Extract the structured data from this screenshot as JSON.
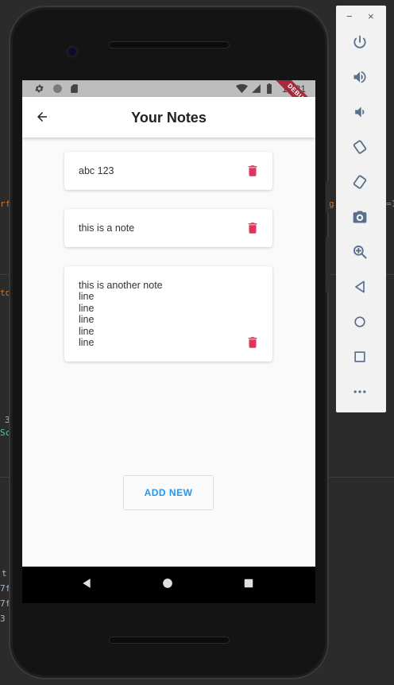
{
  "ide": {
    "frag_1": "rf",
    "frag_2": "to",
    "frag_3": "3",
    "frag_4": "Sc",
    "frag_5": "t",
    "frag_6": "7f",
    "frag_7": "7f",
    "frag_8": "3",
    "frag_9": "g",
    "frag_10": "=1"
  },
  "status_bar": {
    "time": "10:21",
    "debug_label": "DEBUG"
  },
  "app_bar": {
    "title": "Your Notes"
  },
  "notes": [
    {
      "text": "abc 123"
    },
    {
      "text": "this is a note"
    },
    {
      "text": "this is another note\nline\nline\nline\nline\nline"
    }
  ],
  "actions": {
    "add_new_label": "ADD NEW"
  },
  "emulator": {
    "minimize": "−",
    "close": "×"
  },
  "colors": {
    "accent": "#2196f3",
    "trash": "#e0345c",
    "status_bar": "#bdbdbd",
    "debug_banner": "#a52a3a"
  },
  "icons": {
    "back": "arrow-left-icon",
    "delete": "trash-icon",
    "power": "power-icon",
    "volume_up": "volume-up-icon",
    "volume_down": "volume-down-icon",
    "rotate_left": "rotate-left-icon",
    "rotate_right": "rotate-right-icon",
    "screenshot": "camera-icon",
    "zoom": "zoom-icon",
    "back_nav": "triangle-back-icon",
    "home_nav": "circle-home-icon",
    "overview_nav": "square-overview-icon",
    "more": "more-icon"
  }
}
